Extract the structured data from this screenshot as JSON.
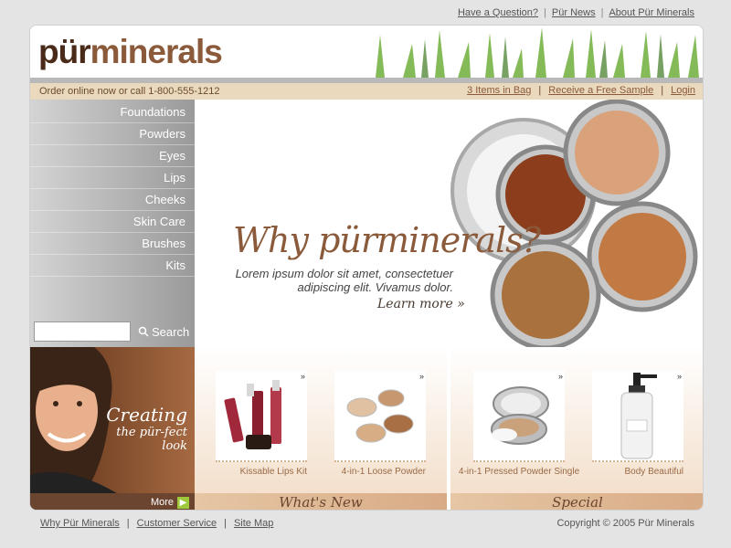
{
  "top_links": [
    "Have a Question?",
    "Pür News",
    "About Pür Minerals"
  ],
  "logo": {
    "part1": "pür",
    "part2": "minerals"
  },
  "order_text": "Order online now or call 1-800-555-1212",
  "account_links": [
    "3 Items in Bag",
    "Receive a Free Sample",
    "Login"
  ],
  "nav": [
    "Foundations",
    "Powders",
    "Eyes",
    "Lips",
    "Cheeks",
    "Skin Care",
    "Brushes",
    "Kits"
  ],
  "search": {
    "button": "Search",
    "value": ""
  },
  "hero": {
    "title": "Why pürminerals?",
    "body": "Lorem ipsum dolor sit amet, consectetuer adipiscing elit. Vivamus dolor.",
    "cta": "Learn more »"
  },
  "promo": {
    "line1": "Creating",
    "line2": "the pür-fect",
    "line3": "look",
    "more": "More"
  },
  "whats_new": {
    "heading": "What's New",
    "products": [
      "Kissable Lips Kit",
      "4-in-1 Loose Powder"
    ]
  },
  "special": {
    "heading": "Special",
    "products": [
      "4-in-1 Pressed Powder Single",
      "Body Beautiful"
    ]
  },
  "footer": {
    "links": [
      "Why Pür Minerals",
      "Customer Service",
      "Site Map"
    ],
    "copyright": "Copyright © 2005 Pür Minerals"
  },
  "colors": {
    "brand_brown": "#8a5a3a",
    "bar_tan": "#ead9bd",
    "sidebar_gray": "#9a9a9a",
    "accent_green": "#9dc93a"
  }
}
